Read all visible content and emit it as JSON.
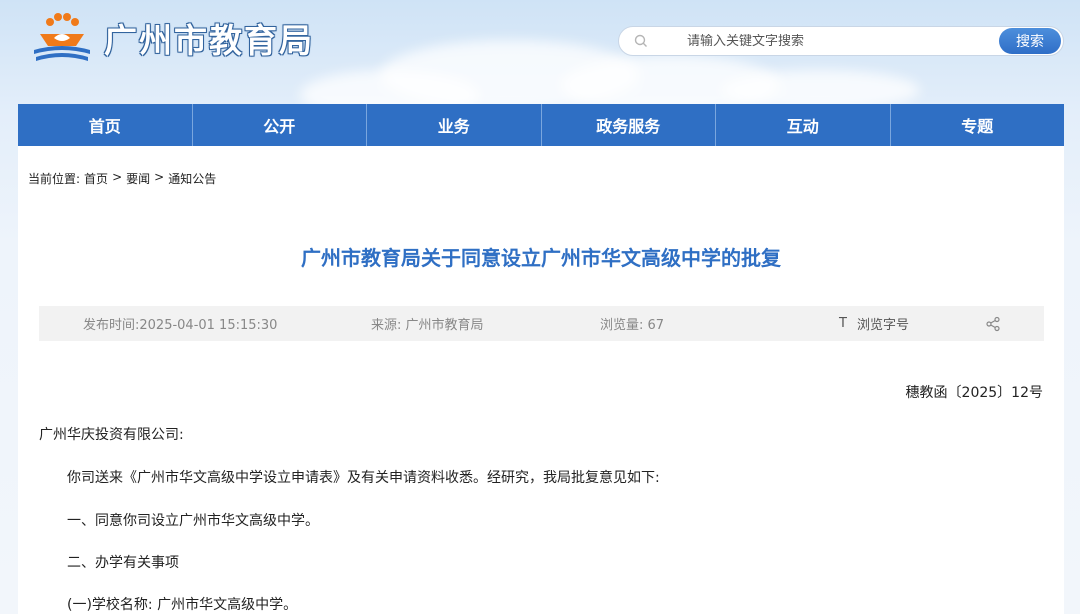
{
  "header": {
    "site_title": "广州市教育局",
    "search": {
      "placeholder": "请输入关键文字搜索",
      "button_label": "搜索"
    }
  },
  "nav": {
    "items": [
      {
        "label": "首页"
      },
      {
        "label": "公开"
      },
      {
        "label": "业务"
      },
      {
        "label": "政务服务"
      },
      {
        "label": "互动"
      },
      {
        "label": "专题"
      }
    ]
  },
  "breadcrumb": {
    "prefix": "当前位置:",
    "items": [
      "首页",
      "要闻",
      "通知公告"
    ],
    "separator": ">"
  },
  "article": {
    "title": "广州市教育局关于同意设立广州市华文高级中学的批复",
    "meta": {
      "publish_time": "发布时间:2025-04-01 15:15:30",
      "source": "来源: 广州市教育局",
      "views": "浏览量: 67",
      "font_size_icon_glyph": "T",
      "font_size_label": "浏览字号"
    },
    "doc_number": "穗教函〔2025〕12号",
    "paragraphs": [
      "广州华庆投资有限公司:",
      "你司送来《广州市华文高级中学设立申请表》及有关申请资料收悉。经研究，我局批复意见如下:",
      "一、同意你司设立广州市华文高级中学。",
      "二、办学有关事项",
      "(一)学校名称: 广州市华文高级中学。"
    ]
  },
  "colors": {
    "nav_bg": "#2f6fc4",
    "title": "#2f6fc4",
    "meta_bg": "#f2f2f2",
    "logo_orange": "#f07a1a",
    "logo_blue": "#2f6fc4"
  }
}
